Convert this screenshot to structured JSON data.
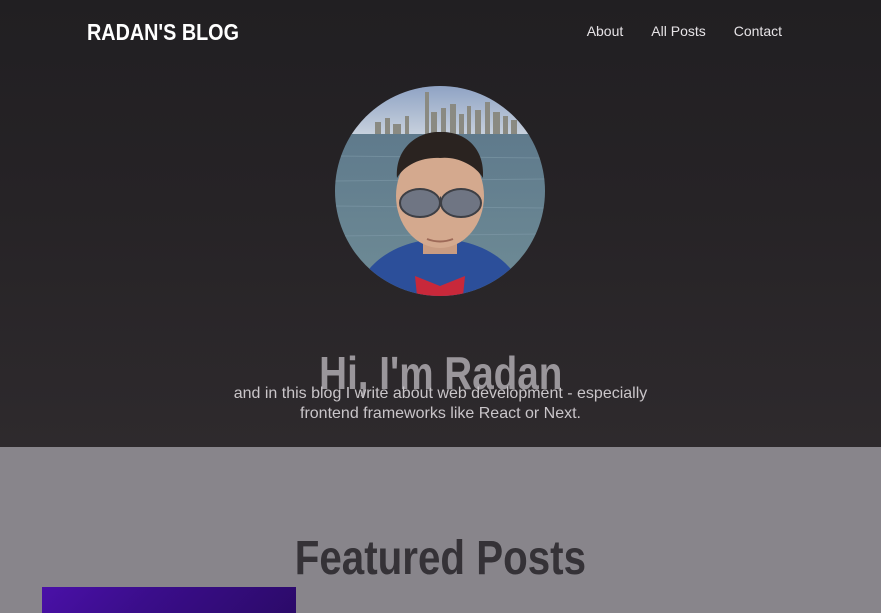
{
  "header": {
    "logo": "RADAN'S BLOG",
    "nav": [
      {
        "label": "About"
      },
      {
        "label": "All Posts"
      },
      {
        "label": "Contact"
      }
    ]
  },
  "hero": {
    "title": "Hi, I'm Radan",
    "subtitle_line1": "and in this blog I write about web development - especially",
    "subtitle_line2": "frontend frameworks like React or Next."
  },
  "featured": {
    "title": "Featured Posts"
  },
  "colors": {
    "hero_bg": "#262326",
    "section_bg": "#88858b",
    "title_gray": "#9a969b",
    "featured_title": "#353237",
    "card_purple": "#4a10a8"
  }
}
